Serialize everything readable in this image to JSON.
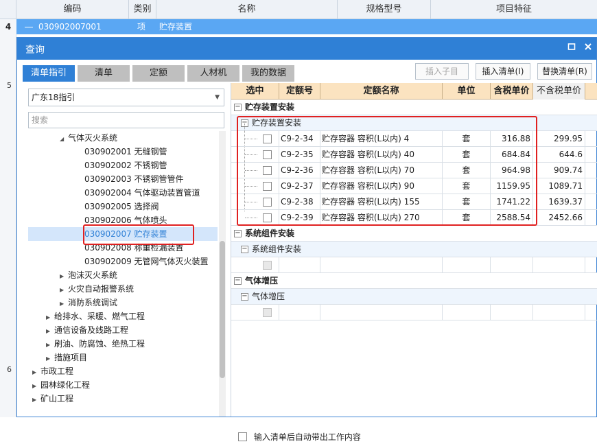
{
  "bg_table": {
    "headers": [
      "编码",
      "类别",
      "名称",
      "规格型号",
      "项目特征"
    ],
    "row": {
      "num": "4",
      "code": "030902007001",
      "type": "项",
      "name": "贮存装置"
    },
    "side_numbers": [
      "5",
      "6"
    ]
  },
  "dialog": {
    "title": "查询",
    "tabs": [
      "清单指引",
      "清单",
      "定额",
      "人材机",
      "我的数据"
    ],
    "buttons": {
      "insert_child": "插入子目",
      "insert_list": "插入清单(I)",
      "replace_list": "替换清单(R)"
    },
    "select_value": "广东18指引",
    "search_placeholder": "搜索",
    "tree": [
      "气体灭火系统",
      "030902001 无缝钢管",
      "030902002 不锈钢管",
      "030902003 不锈钢管管件",
      "030902004 气体驱动装置管道",
      "030902005 选择阀",
      "030902006 气体喷头",
      "030902007 贮存装置",
      "030902008 称重检漏装置",
      "030902009 无管网气体灭火装置",
      "泡沫灭火系统",
      "火灾自动报警系统",
      "消防系统调试",
      "给排水、采暖、燃气工程",
      "通信设备及线路工程",
      "刷油、防腐蚀、绝热工程",
      "措施项目",
      "市政工程",
      "园林绿化工程",
      "矿山工程"
    ],
    "grid": {
      "headers": [
        "选中",
        "定额号",
        "定额名称",
        "单位",
        "含税单价",
        "不含税单价"
      ],
      "groups": [
        {
          "title": "贮存装置安装",
          "sub": "贮存装置安装",
          "rows": [
            {
              "code": "C9-2-34",
              "name": "贮存容器 容积(L以内) 4",
              "unit": "套",
              "tax": "316.88",
              "notax": "299.95"
            },
            {
              "code": "C9-2-35",
              "name": "贮存容器 容积(L以内) 40",
              "unit": "套",
              "tax": "684.84",
              "notax": "644.6"
            },
            {
              "code": "C9-2-36",
              "name": "贮存容器 容积(L以内) 70",
              "unit": "套",
              "tax": "964.98",
              "notax": "909.74"
            },
            {
              "code": "C9-2-37",
              "name": "贮存容器 容积(L以内) 90",
              "unit": "套",
              "tax": "1159.95",
              "notax": "1089.71"
            },
            {
              "code": "C9-2-38",
              "name": "贮存容器 容积(L以内) 155",
              "unit": "套",
              "tax": "1741.22",
              "notax": "1639.37"
            },
            {
              "code": "C9-2-39",
              "name": "贮存容器 容积(L以内) 270",
              "unit": "套",
              "tax": "2588.54",
              "notax": "2452.66"
            }
          ]
        },
        {
          "title": "系统组件安装",
          "sub": "系统组件安装",
          "rows": []
        },
        {
          "title": "气体增压",
          "sub": "气体增压",
          "rows": []
        }
      ]
    },
    "footer_checkbox": "输入清单后自动带出工作内容"
  }
}
